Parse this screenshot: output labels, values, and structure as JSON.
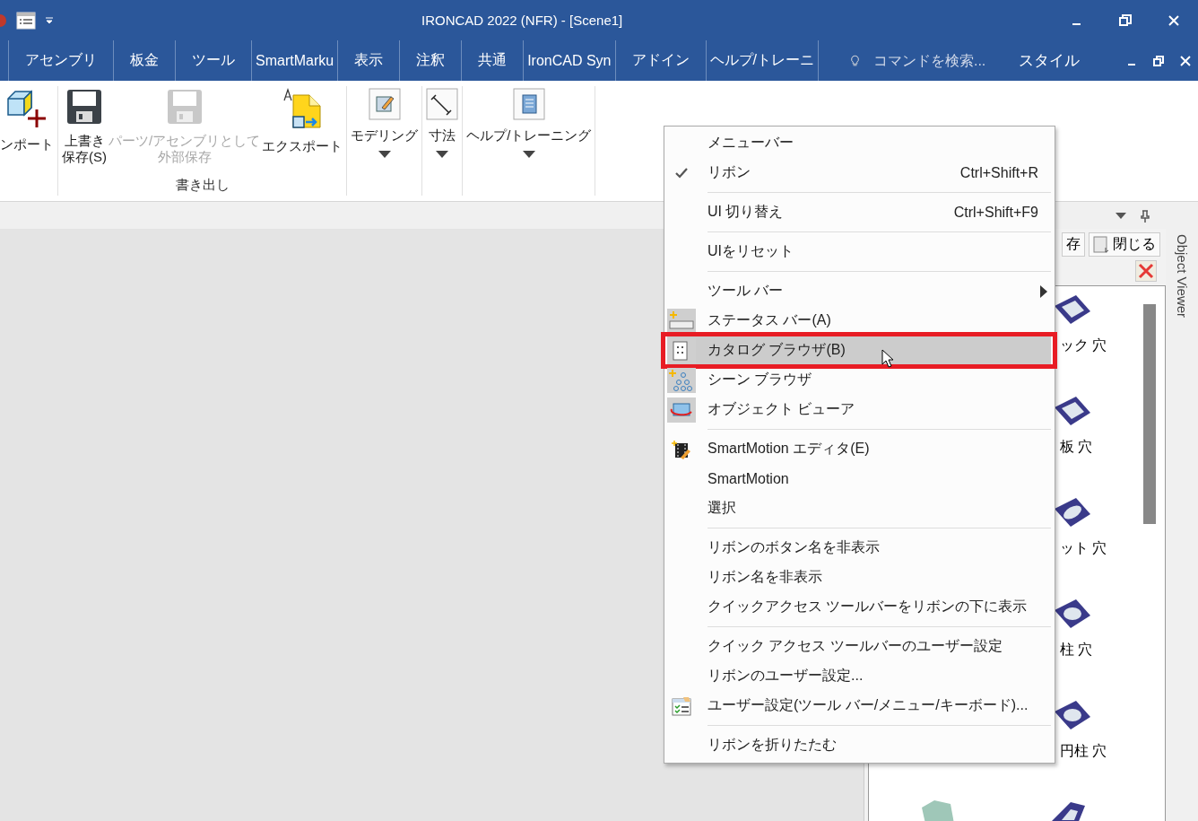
{
  "title_bar": {
    "title": "IRONCAD 2022 (NFR) - [Scene1]"
  },
  "ribbon_tabs": [
    {
      "label": "アセンブリ"
    },
    {
      "label": "板金"
    },
    {
      "label": "ツール"
    },
    {
      "label": "SmartMarku"
    },
    {
      "label": "表示"
    },
    {
      "label": "注釈"
    },
    {
      "label": "共通"
    },
    {
      "label": "IronCAD Syn"
    },
    {
      "label": "アドイン"
    },
    {
      "label": "ヘルプ/トレーニ"
    }
  ],
  "search": {
    "placeholder": "コマンドを検索..."
  },
  "style_menu": {
    "label": "スタイル"
  },
  "ribbon_groups": [
    {
      "buttons": [
        {
          "lines": [
            "ンポート"
          ],
          "kind": "import",
          "disabled": false
        }
      ]
    },
    {
      "label": "書き出し",
      "buttons": [
        {
          "lines": [
            "上書き",
            "保存(S)"
          ],
          "kind": "save",
          "disabled": false
        },
        {
          "lines": [
            "パーツ/アセンブリとして",
            "外部保存"
          ],
          "kind": "save",
          "disabled": true
        },
        {
          "lines": [
            "エクスポート"
          ],
          "kind": "export",
          "disabled": false
        }
      ]
    },
    {
      "buttons": [
        {
          "lines": [
            "モデリング"
          ],
          "kind": "modeling",
          "disabled": false
        }
      ]
    },
    {
      "buttons": [
        {
          "lines": [
            "寸法"
          ],
          "kind": "dimension",
          "disabled": false
        }
      ]
    },
    {
      "buttons": [
        {
          "lines": [
            "ヘルプ/トレーニング"
          ],
          "kind": "manual",
          "disabled": false
        }
      ]
    }
  ],
  "context_menu": {
    "sections": [
      {
        "items": [
          {
            "label": "メニューバー",
            "kind": "plain",
            "checked": false,
            "selected": false
          },
          {
            "label": "リボン",
            "shortcut": "Ctrl+Shift+R",
            "kind": "plain",
            "checked": true,
            "selected": false
          }
        ]
      },
      {
        "items": [
          {
            "label": "UI 切り替え",
            "shortcut": "Ctrl+Shift+F9",
            "kind": "plain",
            "checked": false,
            "selected": false
          }
        ]
      },
      {
        "items": [
          {
            "label": "UIをリセット",
            "kind": "plain",
            "checked": false,
            "selected": false
          }
        ]
      },
      {
        "items": [
          {
            "label": "ツール バー",
            "kind": "submenu",
            "checked": false,
            "selected": false
          },
          {
            "label": "ステータス バー(A)",
            "kind": "statusbar",
            "checked": false,
            "selected": false
          },
          {
            "label": "カタログ ブラウザ(B)",
            "kind": "catalog",
            "checked": false,
            "selected": true
          },
          {
            "label": "シーン ブラウザ",
            "kind": "scene",
            "checked": false,
            "selected": false
          },
          {
            "label": "オブジェクト ビューア",
            "kind": "viewer",
            "checked": false,
            "selected": false
          }
        ]
      },
      {
        "items": [
          {
            "label": "SmartMotion エディタ(E)",
            "kind": "film",
            "checked": false,
            "selected": false
          },
          {
            "label": "SmartMotion",
            "kind": "plain",
            "checked": false,
            "selected": false
          },
          {
            "label": "選択",
            "kind": "plain",
            "checked": false,
            "selected": false
          }
        ]
      },
      {
        "items": [
          {
            "label": "リボンのボタン名を非表示",
            "kind": "plain",
            "checked": false,
            "selected": false
          },
          {
            "label": "リボン名を非表示",
            "kind": "plain",
            "checked": false,
            "selected": false
          },
          {
            "label": "クイックアクセス ツールバーをリボンの下に表示",
            "kind": "plain",
            "checked": false,
            "selected": false
          }
        ]
      },
      {
        "items": [
          {
            "label": "クイック アクセス ツールバーのユーザー設定",
            "kind": "plain",
            "checked": false,
            "selected": false
          },
          {
            "label": "リボンのユーザー設定...",
            "kind": "plain",
            "checked": false,
            "selected": false
          },
          {
            "label": "ユーザー設定(ツール バー/メニュー/キーボード)...",
            "kind": "customize",
            "checked": false,
            "selected": false
          }
        ]
      },
      {
        "items": [
          {
            "label": "リボンを折りたたむ",
            "kind": "plain",
            "checked": false,
            "selected": false
          }
        ]
      }
    ]
  },
  "catalog_panel": {
    "buttons": [
      {
        "label": "存"
      },
      {
        "label": "閉じる"
      }
    ],
    "items": [
      {
        "label": "ック 穴",
        "kind": "square"
      },
      {
        "label": "板 穴",
        "kind": "square"
      },
      {
        "label": "ット 穴",
        "kind": "slot"
      },
      {
        "label": "柱 穴",
        "kind": "round"
      },
      {
        "label": "円柱 穴",
        "kind": "round"
      }
    ],
    "side_tab": "Object Viewer"
  }
}
